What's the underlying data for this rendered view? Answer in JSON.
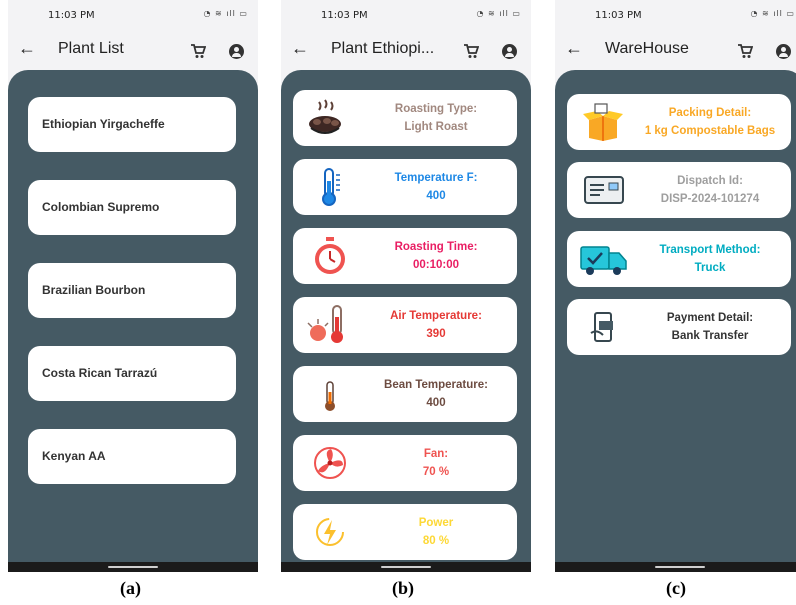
{
  "status": {
    "time": "11:03 PM"
  },
  "screens": {
    "a": {
      "title": "Plant List",
      "items": [
        "Ethiopian Yirgacheffe",
        "Colombian Supremo",
        "Brazilian Bourbon",
        "Costa Rican Tarrazú",
        "Kenyan AA"
      ],
      "caption": "(a)"
    },
    "b": {
      "title": "Plant Ethiopi...",
      "cards": [
        {
          "label": "Roasting Type:",
          "value": "Light Roast",
          "color": "#a1887f",
          "icon": "coffee-beans-icon"
        },
        {
          "label": "Temperature F:",
          "value": "400",
          "color": "#1e88e5",
          "icon": "thermometer-icon"
        },
        {
          "label": "Roasting Time:",
          "value": "00:10:00",
          "color": "#e91e63",
          "icon": "stopwatch-icon"
        },
        {
          "label": "Air Temperature:",
          "value": "390",
          "color": "#e53935",
          "icon": "hot-thermometer-icon"
        },
        {
          "label": "Bean Temperature:",
          "value": "400",
          "color": "#6d4c41",
          "icon": "small-thermometer-icon"
        },
        {
          "label": "Fan:",
          "value": "70 %",
          "color": "#ef5350",
          "icon": "fan-icon"
        },
        {
          "label": "Power",
          "value": "80 %",
          "color": "#fdd835",
          "icon": "lightning-icon"
        }
      ],
      "caption": "(b)"
    },
    "c": {
      "title": "WareHouse",
      "cards": [
        {
          "label": "Packing Detail:",
          "value": "1 kg Compostable Bags",
          "color": "#f9a825",
          "icon": "package-icon"
        },
        {
          "label": "Dispatch Id:",
          "value": "DISP-2024-101274",
          "color": "#9e9e9e",
          "icon": "id-card-icon"
        },
        {
          "label": "Transport Method:",
          "value": "Truck",
          "color": "#00acc1",
          "icon": "truck-icon"
        },
        {
          "label": "Payment Detail:",
          "value": "Bank Transfer",
          "color": "#333333",
          "icon": "mobile-payment-icon"
        }
      ],
      "caption": "(c)"
    }
  }
}
